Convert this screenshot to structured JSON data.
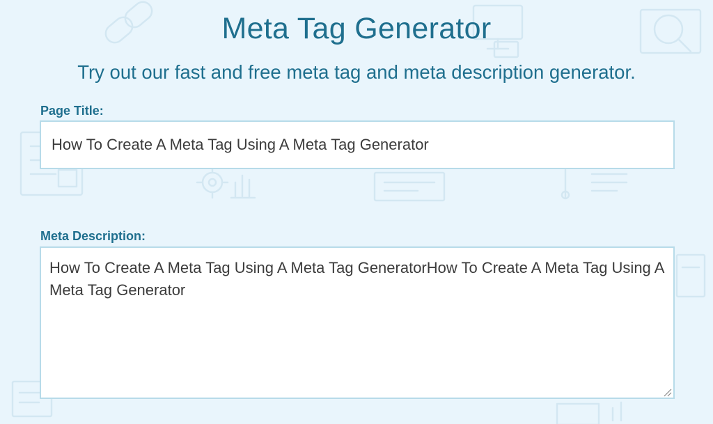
{
  "header": {
    "title": "Meta Tag Generator",
    "subtitle": "Try out our fast and free meta tag and meta description generator."
  },
  "form": {
    "page_title": {
      "label": "Page Title:",
      "value": "How To Create A Meta Tag Using A Meta Tag Generator"
    },
    "meta_description": {
      "label": "Meta Description:",
      "value": "How To Create A Meta Tag Using A Meta Tag GeneratorHow To Create A Meta Tag Using A Meta Tag Generator"
    }
  },
  "colors": {
    "background": "#e9f5fc",
    "heading": "#1f6f8e",
    "input_border": "#b7dbe9",
    "decor_line": "#d3e7f2"
  },
  "icons": [
    "link-icon",
    "monitor-icon",
    "magnifier-icon",
    "document-icon",
    "gear-icon",
    "bar-chart-icon",
    "pen-icon",
    "laptop-icon",
    "resize-grip-icon"
  ]
}
